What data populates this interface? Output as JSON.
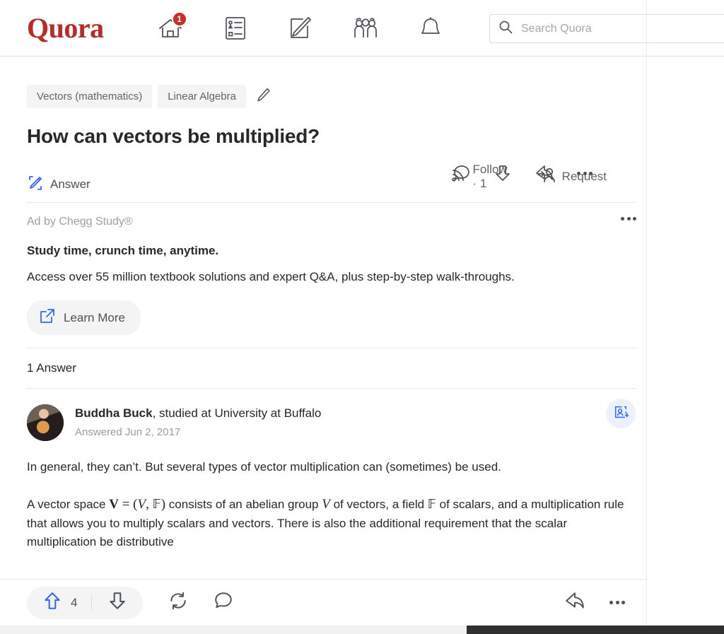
{
  "header": {
    "logo": "Quora",
    "nav": [
      {
        "name": "home",
        "icon": "home-icon",
        "badge": "1"
      },
      {
        "name": "answers",
        "icon": "list-icon",
        "badge": ""
      },
      {
        "name": "write",
        "icon": "pencil-square-icon",
        "badge": ""
      },
      {
        "name": "spaces",
        "icon": "people-icon",
        "badge": ""
      },
      {
        "name": "notifications",
        "icon": "bell-icon",
        "badge": ""
      }
    ],
    "search": {
      "placeholder": "Search Quora",
      "value": "",
      "icon": "search-icon"
    }
  },
  "question": {
    "topics": [
      "Vectors (mathematics)",
      "Linear Algebra"
    ],
    "edit_icon": "pencil-icon",
    "title": "How can vectors be multiplied?",
    "actions": [
      {
        "label": "Answer",
        "icon": "pencil-write-icon"
      },
      {
        "label": "Follow · 1",
        "icon": "rss-follow-icon"
      },
      {
        "label": "Request",
        "icon": "request-person-icon"
      }
    ],
    "right_actions": [
      {
        "name": "comment-icon"
      },
      {
        "name": "downvote-icon"
      },
      {
        "name": "share-icon"
      },
      {
        "name": "more-icon"
      }
    ]
  },
  "ad": {
    "label": "Ad by Chegg Study®",
    "more_icon": "more-icon",
    "headline": "Study time, crunch time, anytime.",
    "body": "Access over 55 million textbook solutions and expert Q&A, plus step-by-step walk-throughs.",
    "cta_label": "Learn More",
    "cta_icon": "external-link-icon"
  },
  "answers": {
    "count_label": "1 Answer",
    "author": {
      "name": "Buddha Buck",
      "credential": ", studied at University at Buffalo",
      "answered": "Answered Jun 2, 2017",
      "avatar": "author-avatar",
      "follow_icon": "add-person-icon"
    },
    "paragraph1": "In general, they can’t. But several types of vector multiplication can (sometimes) be used.",
    "paragraph2": {
      "part1": "A vector space ",
      "math_bold_v": "V",
      "math_eq": " = (",
      "math_italic_v": "V",
      "math_comma": ", ",
      "math_field": "𝔽",
      "math_close": ")",
      "part2": " consists of an abelian group ",
      "math_italic_v2": "V",
      "part3": " of vectors, a field ",
      "math_field2": "𝔽",
      "part4": " of scalars, and a multiplication rule that allows you to multiply scalars and vectors. There"
    },
    "paragraph2_cut": "is also the additional requirement that the scalar multiplication be distributive"
  },
  "footer": {
    "upvote_icon": "upvote-icon",
    "upvote_count": "4",
    "downvote_icon": "downvote-icon",
    "repost_icon": "repost-icon",
    "comment_icon": "comment-icon",
    "share_icon": "share-icon",
    "more_icon": "more-icon"
  },
  "colors": {
    "brand_red": "#b92b27",
    "badge_red": "#cc2b26",
    "accent_blue": "#2e69ff",
    "text_dark": "#282829",
    "text_gray": "#636363",
    "muted_gray": "#9b9b9b"
  }
}
